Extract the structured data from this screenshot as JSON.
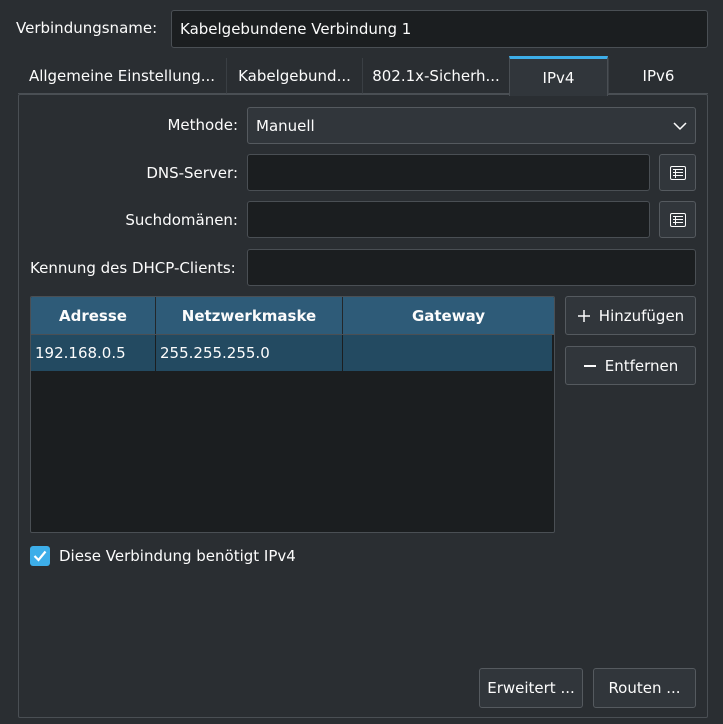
{
  "connection": {
    "name_label": "Verbindungsname:",
    "name_value": "Kabelgebundene Verbindung 1"
  },
  "tabs": [
    {
      "label": "Allgemeine Einstellung..."
    },
    {
      "label": "Kabelgebund..."
    },
    {
      "label": "802.1x-Sicherh..."
    },
    {
      "label": "IPv4",
      "active": true
    },
    {
      "label": "IPv6"
    }
  ],
  "form": {
    "method_label": "Methode:",
    "method_value": "Manuell",
    "dns_label": "DNS-Server:",
    "dns_value": "",
    "search_label": "Suchdomänen:",
    "search_value": "",
    "dhcp_label": "Kennung des DHCP-Clients:",
    "dhcp_value": ""
  },
  "table": {
    "headers": [
      "Adresse",
      "Netzwerkmaske",
      "Gateway"
    ],
    "rows": [
      [
        "192.168.0.5",
        "255.255.255.0",
        ""
      ]
    ]
  },
  "buttons": {
    "add": "Hinzufügen",
    "remove": "Entfernen",
    "advanced": "Erweitert ...",
    "routes": "Routen ..."
  },
  "require_ipv4": {
    "label": "Diese Verbindung benötigt IPv4",
    "checked": true
  },
  "colors": {
    "accent": "#3daee9",
    "background": "#2a2e32",
    "selection": "#234a61"
  },
  "icons": {
    "list_edit": "list-edit-icon",
    "add": "plus-icon",
    "remove": "minus-icon",
    "dropdown": "chevron-down-icon",
    "check": "checkmark-icon"
  }
}
